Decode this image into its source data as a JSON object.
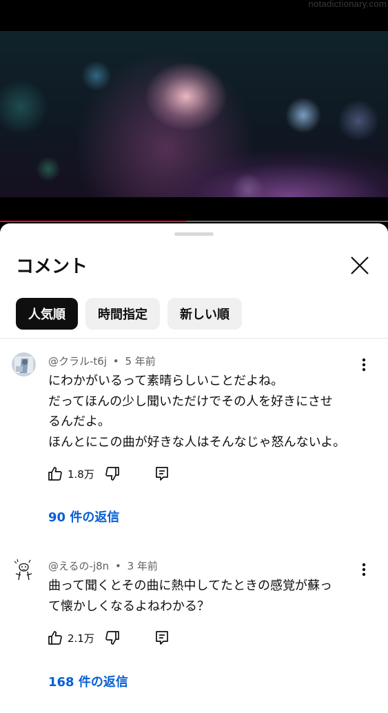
{
  "watermark": "notadictionary.com",
  "video": {
    "progress_fraction": 0.48,
    "progress_color": "#ff0033"
  },
  "sheet": {
    "title": "コメント",
    "close_icon": "close-icon",
    "sort_chips": [
      {
        "label": "人気順",
        "selected": true
      },
      {
        "label": "時間指定",
        "selected": false
      },
      {
        "label": "新しい順",
        "selected": false
      }
    ]
  },
  "comments": [
    {
      "author": "@クラル-t6j",
      "age": "5 年前",
      "lines": [
        "にわかがいるって素晴らしいことだよね。",
        "だってほんの少し聞いただけでその人を好きにさせ",
        "るんだよ。",
        "ほんとにこの曲が好きな人はそんなじゃ怒んないよ。"
      ],
      "likes": "1.8万",
      "replies_label": "90 件の返信",
      "avatar": "avatar"
    },
    {
      "author": "@えるの-j8n",
      "age": "3 年前",
      "lines": [
        "曲って聞くとその曲に熱中してたときの感覚が蘇っ",
        "て懐かしくなるよねわかる？"
      ],
      "likes": "2.1万",
      "replies_label": "168 件の返信",
      "avatar": "avatar"
    }
  ],
  "meta_separator": "•",
  "colors": {
    "link": "#065fd4",
    "chip_active": "#0f0f0f",
    "chip": "#f0f0f0",
    "text_secondary": "#606060"
  }
}
